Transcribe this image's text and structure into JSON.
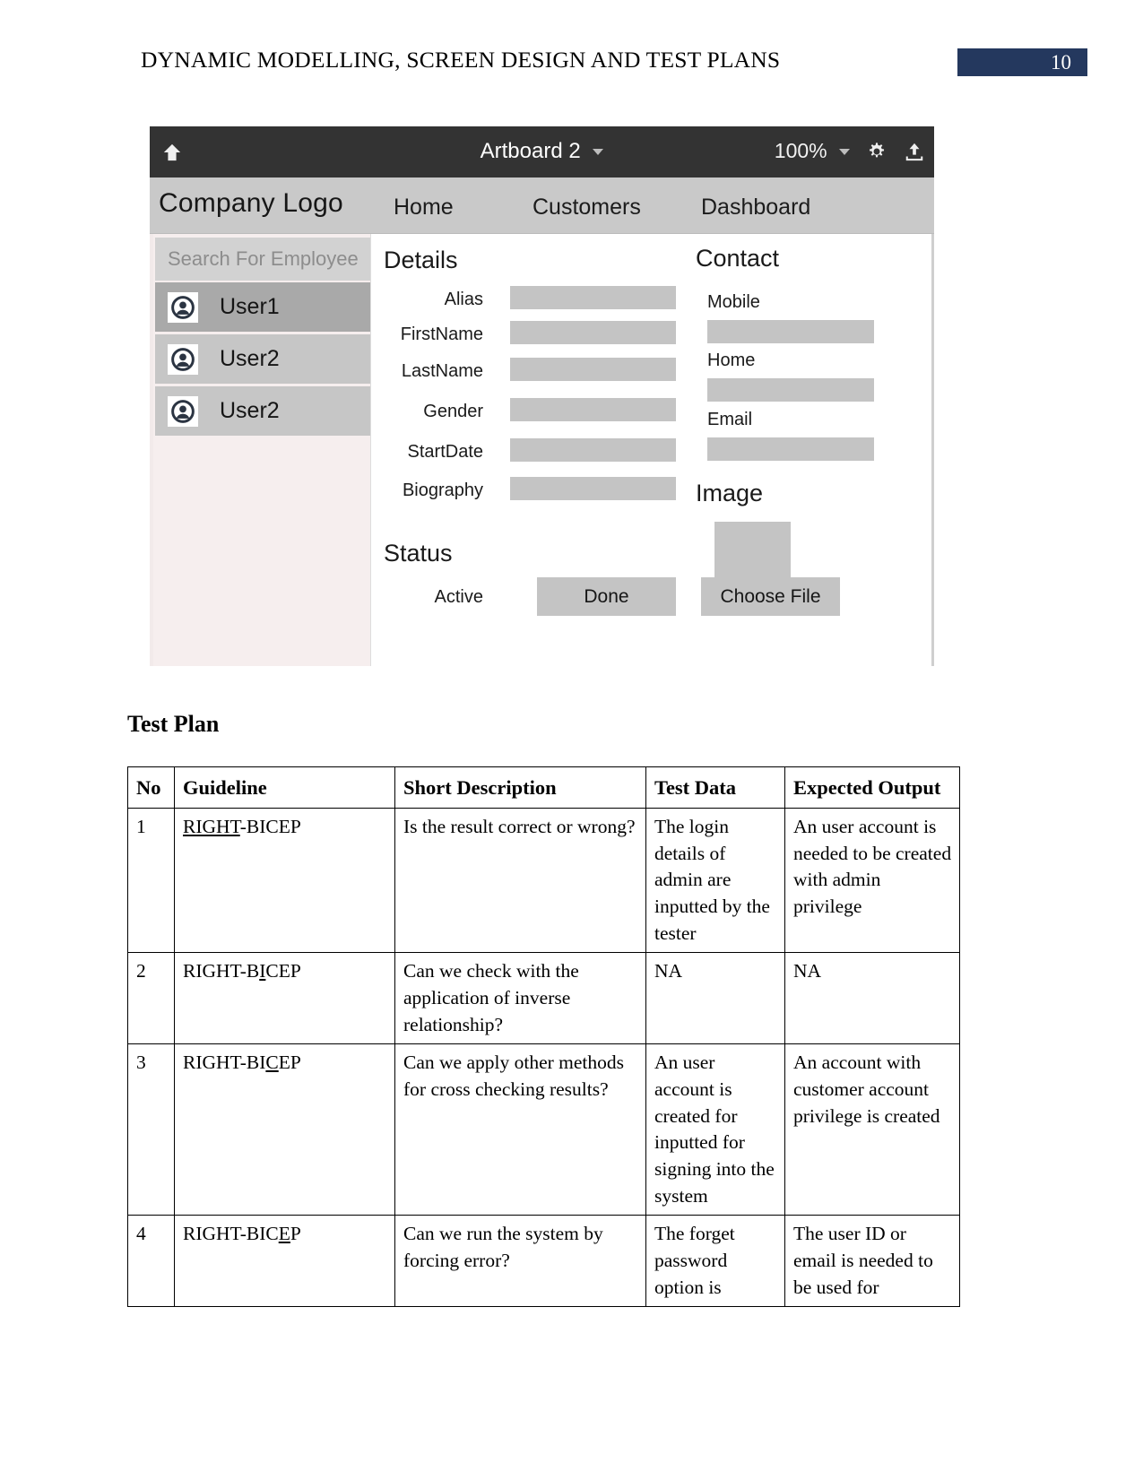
{
  "header": {
    "doc_title": "DYNAMIC MODELLING, SCREEN DESIGN AND TEST PLANS",
    "page_number": "10",
    "badge_color": "#24385e"
  },
  "mockup": {
    "topbar": {
      "home_icon": "home-icon",
      "artboard_label": "Artboard 2",
      "zoom_label": "100%",
      "gear_icon": "gear-icon",
      "upload_icon": "upload-icon"
    },
    "nav": {
      "logo": "Company Logo",
      "links": [
        {
          "label": "Home"
        },
        {
          "label": "Customers"
        },
        {
          "label": "Dashboard"
        }
      ]
    },
    "sidebar": {
      "search_placeholder": "Search For Employee",
      "users": [
        {
          "label": "User1",
          "selected": true
        },
        {
          "label": "User2",
          "selected": false
        },
        {
          "label": "User2",
          "selected": false
        }
      ]
    },
    "form": {
      "details_title": "Details",
      "details_fields": [
        {
          "label": "Alias"
        },
        {
          "label": "FirstName"
        },
        {
          "label": "LastName"
        },
        {
          "label": "Gender"
        },
        {
          "label": "StartDate"
        },
        {
          "label": "Biography"
        }
      ],
      "contact_title": "Contact",
      "contact_fields": [
        {
          "label": "Mobile"
        },
        {
          "label": "Home"
        },
        {
          "label": "Email"
        }
      ],
      "status_title": "Status",
      "status_field_label": "Active",
      "done_button": "Done",
      "image_title": "Image",
      "choose_file_button": "Choose File"
    }
  },
  "testplan": {
    "heading": "Test Plan",
    "columns": [
      "No",
      "Guideline",
      "Short Description",
      "Test Data",
      "Expected Output"
    ],
    "rows": [
      {
        "no": "1",
        "guideline_pre": "",
        "guideline_underline": "RIGHT",
        "guideline_post": "-BICEP",
        "description": "Is the result correct or wrong?",
        "test_data": "The login details of admin are inputted by the tester",
        "expected_output": "An user account is needed to be created with admin privilege"
      },
      {
        "no": "2",
        "guideline_pre": "RIGHT-B",
        "guideline_underline": "I",
        "guideline_post": "CEP",
        "description": "Can we check with the application of inverse relationship?",
        "test_data": "NA",
        "expected_output": "NA"
      },
      {
        "no": "3",
        "guideline_pre": "RIGHT-BI",
        "guideline_underline": "C",
        "guideline_post": "EP",
        "description": "Can we apply other methods for cross checking results?",
        "test_data": "An user account is created for inputted for signing into the system",
        "expected_output": "An account with customer account privilege is created"
      },
      {
        "no": "4",
        "guideline_pre": "RIGHT-BIC",
        "guideline_underline": "E",
        "guideline_post": "P",
        "description": "Can we run the system by forcing error?",
        "test_data": "The forget password option is",
        "expected_output": "The user ID or email is needed to be used for"
      }
    ]
  }
}
